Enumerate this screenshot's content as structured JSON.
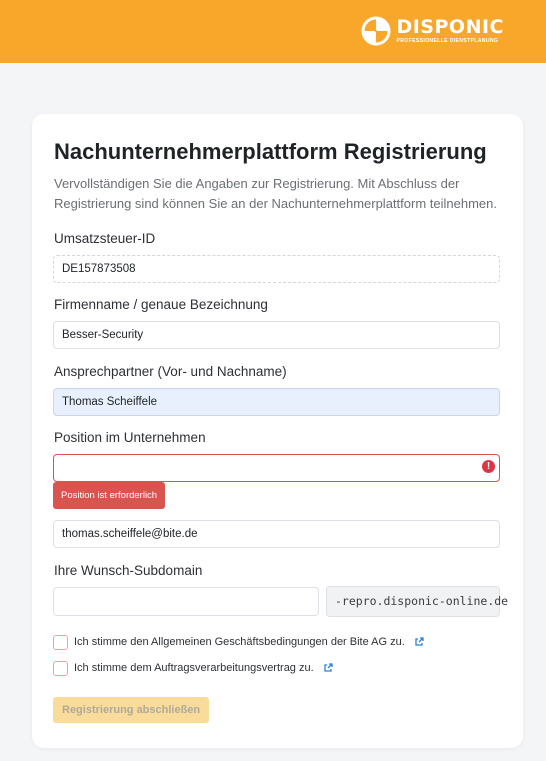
{
  "brand": {
    "name": "DISPONIC",
    "tagline": "PROFESSIONELLE DIENSTPLANUNG",
    "header_color": "#f9a72b",
    "logo_icon": "disponic-logo-icon"
  },
  "form": {
    "title": "Nachunternehmerplattform Registrierung",
    "subtitle": "Vervollständigen Sie die Angaben zur Registrierung. Mit Abschluss der Registrierung sind können Sie an der Nachunternehmerplattform teilnehmen.",
    "vat": {
      "label": "Umsatzsteuer-ID",
      "value": "DE157873508"
    },
    "company": {
      "label": "Firmenname / genaue Bezeichnung",
      "value": "Besser-Security"
    },
    "contact": {
      "label": "Ansprechpartner (Vor- und Nachname)",
      "value": "Thomas Scheiffele"
    },
    "position": {
      "label": "Position im Unternehmen",
      "value": "",
      "error": "Position ist erforderlich",
      "error_icon": "exclamation-circle-icon"
    },
    "email": {
      "value": "thomas.scheiffele@bite.de"
    },
    "subdomain": {
      "label": "Ihre Wunsch-Subdomain",
      "value": "",
      "suffix": "-repro.disponic-online.de"
    },
    "terms": {
      "label": "Ich stimme den Allgemeinen Geschäftsbedingungen der Bite AG zu.",
      "icon": "external-link-icon"
    },
    "dpa": {
      "label": "Ich stimme dem Auftragsverarbeitungsvertrag zu.",
      "icon": "external-link-icon"
    },
    "submit_label": "Registrierung abschließen"
  }
}
